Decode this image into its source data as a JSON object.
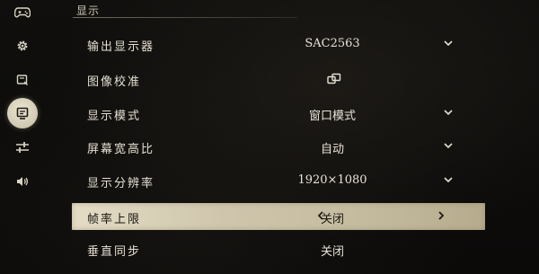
{
  "section": {
    "title": "显示"
  },
  "sidebar": {
    "items": [
      {
        "name": "controller",
        "icon": "controller-icon"
      },
      {
        "name": "general",
        "icon": "gear-icon"
      },
      {
        "name": "hud",
        "icon": "hud-icon"
      },
      {
        "name": "display",
        "icon": "display-icon",
        "active": true
      },
      {
        "name": "advanced",
        "icon": "sliders-icon"
      },
      {
        "name": "audio",
        "icon": "speaker-icon"
      }
    ]
  },
  "settings": {
    "output_display": {
      "label": "输出显示器",
      "value": "SAC2563"
    },
    "calibration": {
      "label": "图像校准"
    },
    "display_mode": {
      "label": "显示模式",
      "value": "窗口模式"
    },
    "aspect_ratio": {
      "label": "屏幕宽高比",
      "value": "自动"
    },
    "resolution": {
      "label": "显示分辨率",
      "value": "1920×1080"
    },
    "frame_rate_limit": {
      "label": "帧率上限",
      "value": "关闭"
    },
    "vsync": {
      "label": "垂直同步",
      "value": "关闭"
    }
  },
  "colors": {
    "background": "#0b0a09",
    "text": "#e4dfd2",
    "highlight": "#d8cfb6",
    "highlight_text": "#1a1712"
  }
}
